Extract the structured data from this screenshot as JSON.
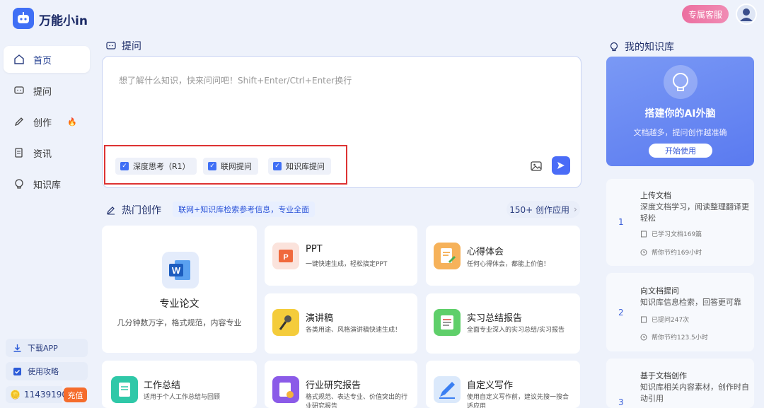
{
  "app": {
    "name": "万能小in"
  },
  "header": {
    "service_label": "专属客服"
  },
  "sidebar": {
    "items": [
      {
        "label": "首页",
        "active": true
      },
      {
        "label": "提问"
      },
      {
        "label": "创作"
      },
      {
        "label": "资讯"
      },
      {
        "label": "知识库"
      }
    ],
    "download_label": "下载APP",
    "guide_label": "使用攻略",
    "coins": "11439190",
    "recharge_label": "充值"
  },
  "ask": {
    "title": "提问",
    "placeholder": "想了解什么知识，快来问问吧！Shift+Enter/Ctrl+Enter换行",
    "options": [
      {
        "label": "深度思考（R1）",
        "checked": true
      },
      {
        "label": "联网提问",
        "checked": true
      },
      {
        "label": "知识库提问",
        "checked": true
      }
    ]
  },
  "hot": {
    "title": "热门创作",
    "desc": "联网+知识库检索参考信息，专业全面",
    "more_label": "150+ 创作应用",
    "featured": {
      "title": "专业论文",
      "desc": "几分钟数万字，格式规范，内容专业"
    },
    "cards": [
      {
        "title": "PPT",
        "desc": "一键快速生成，轻松搞定PPT"
      },
      {
        "title": "心得体会",
        "desc": "任何心得体会，都能上价值！"
      },
      {
        "title": "演讲稿",
        "desc": "各类用途、风格演讲稿快速生成！"
      },
      {
        "title": "实习总结报告",
        "desc": "全面专业深入的实习总结/实习报告"
      },
      {
        "title": "工作总结",
        "desc": "适用于个人工作总结与回顾"
      },
      {
        "title": "行业研究报告",
        "desc": "格式规范、表达专业、价值突出的行业研究报告"
      },
      {
        "title": "自定义写作",
        "desc": "使用自定义写作前，建议先搜一搜合适应用"
      }
    ]
  },
  "kb": {
    "title": "我的知识库",
    "banner_title": "搭建你的AI外脑",
    "banner_sub": "文档越多，提问创作越准确",
    "start_label": "开始使用",
    "steps": [
      {
        "num": "1",
        "title": "上传文档",
        "desc": "深度文档学习，阅读整理翻译更轻松",
        "meta1": "已学习文档169篇",
        "meta2": "帮你节约169小时"
      },
      {
        "num": "2",
        "title": "向文档提问",
        "desc": "知识库信息检索，回答更可靠",
        "meta1": "已提问247次",
        "meta2": "帮你节约123.5小时"
      },
      {
        "num": "3",
        "title": "基于文档创作",
        "desc": "知识库相关内容素材，创作时自动引用"
      }
    ]
  }
}
